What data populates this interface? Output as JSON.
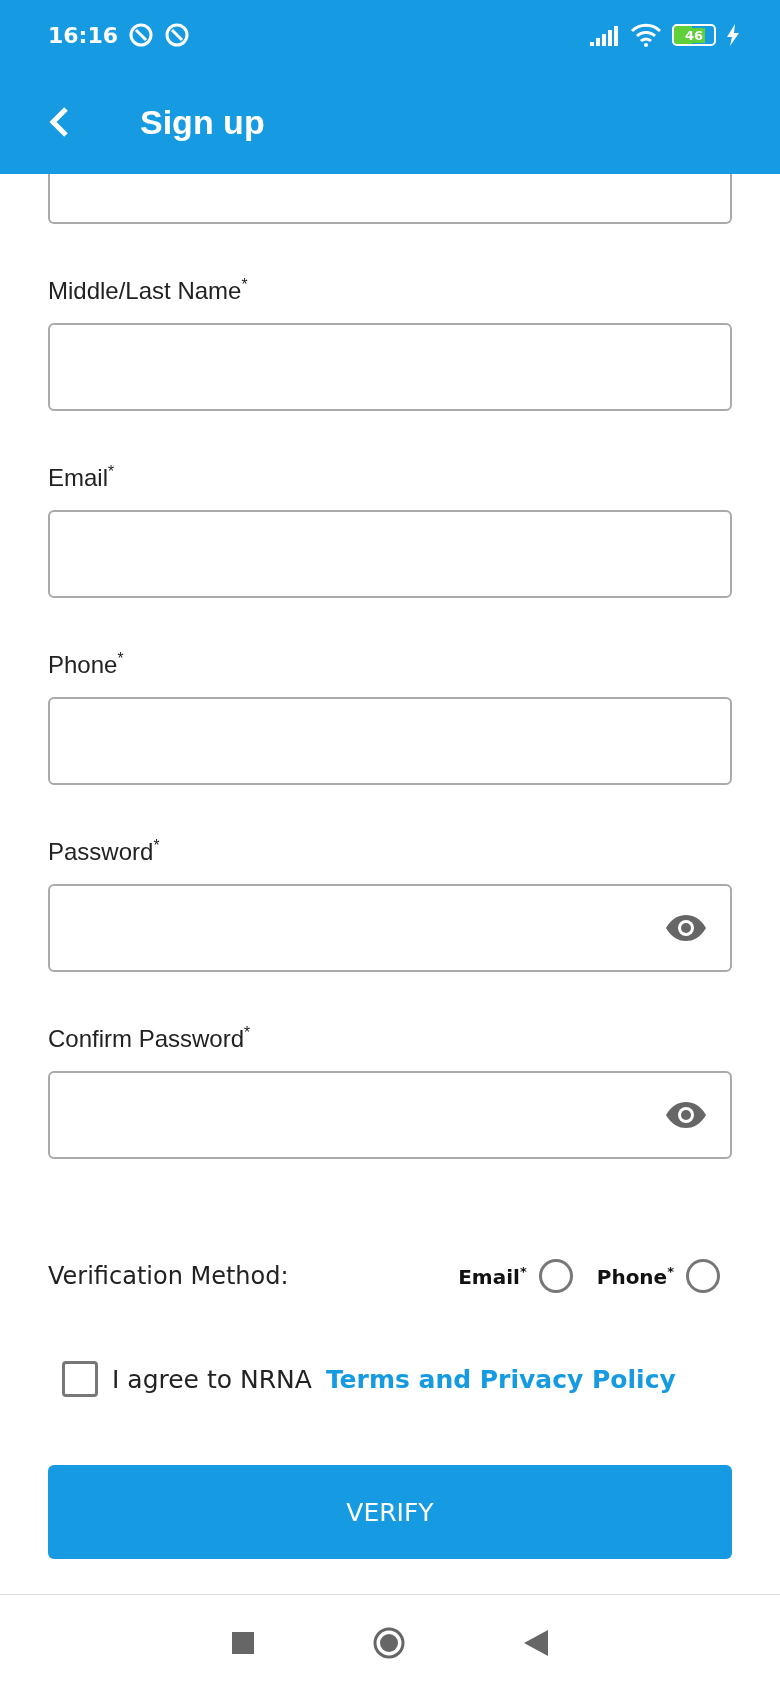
{
  "status_bar": {
    "time": "16:16",
    "battery": "46"
  },
  "app_bar": {
    "title": "Sign up"
  },
  "fields": [
    {
      "kind": "text",
      "clipped_top": true
    },
    {
      "kind": "text",
      "label": "Middle/Last Name$^{*}$",
      "clipped_top": false
    },
    {
      "kind": "text",
      "label": "Email$^{*}$",
      "clipped_top": false
    },
    {
      "kind": "text",
      "label": "Phone$^{*}$",
      "clipped_top": false
    },
    {
      "kind": "password",
      "label": "Password$^{*}$",
      "clipped_top": false
    },
    {
      "kind": "password",
      "label": "Confirm Password$^{*}$",
      "clipped_top": false
    }
  ],
  "verification": {
    "label": "Verification Method:",
    "options": [
      {
        "label": "Email$^{*}$",
        "selected": false
      },
      {
        "label": "Phone$^{*}$",
        "selected": false
      }
    ]
  },
  "agreement": {
    "checked": false,
    "text": "I agree to NRNA",
    "link": "Terms and Privacy Policy"
  },
  "button": "VERIFY"
}
